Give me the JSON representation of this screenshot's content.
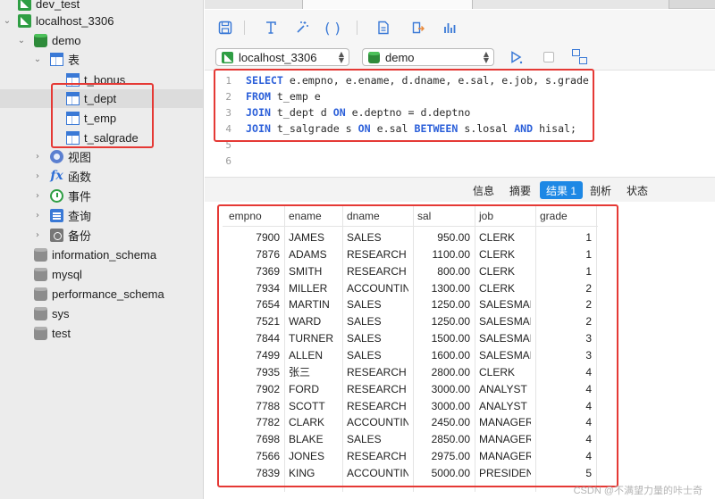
{
  "sidebar": {
    "partial_top": "dev_test",
    "connection": "localhost_3306",
    "database": "demo",
    "tables_group": "表",
    "tables": [
      "t_bonus",
      "t_dept",
      "t_emp",
      "t_salgrade"
    ],
    "folders": [
      "视图",
      "函数",
      "事件",
      "查询",
      "备份"
    ],
    "other_databases": [
      "information_schema",
      "mysql",
      "performance_schema",
      "sys",
      "test"
    ]
  },
  "selectors": {
    "connection": "localhost_3306",
    "database": "demo"
  },
  "editor": {
    "line_numbers": [
      "1",
      "2",
      "3",
      "4",
      "5",
      "6"
    ],
    "lines": [
      {
        "kw": "SELECT",
        "rest": " e.empno, e.ename, d.dname, e.sal, e.job, s.grade"
      },
      {
        "kw": "FROM",
        "rest": " t_emp e"
      },
      {
        "kw": "JOIN",
        "rest": " t_dept d ",
        "kw2": "ON",
        "rest2": " e.deptno = d.deptno"
      },
      {
        "kw": "JOIN",
        "rest": " t_salgrade s ",
        "kw2": "ON",
        "rest2": " e.sal ",
        "kw3": "BETWEEN",
        "rest3": " s.losal ",
        "kw4": "AND",
        "rest4": " hisal;"
      }
    ]
  },
  "result_tabs": [
    "信息",
    "摘要",
    "结果 1",
    "剖析",
    "状态"
  ],
  "result_tab_active": 2,
  "grid": {
    "columns": [
      "empno",
      "ename",
      "dname",
      "sal",
      "job",
      "grade"
    ],
    "rows": [
      [
        "7900",
        "JAMES",
        "SALES",
        "950.00",
        "CLERK",
        "1"
      ],
      [
        "7876",
        "ADAMS",
        "RESEARCH",
        "1100.00",
        "CLERK",
        "1"
      ],
      [
        "7369",
        "SMITH",
        "RESEARCH",
        "800.00",
        "CLERK",
        "1"
      ],
      [
        "7934",
        "MILLER",
        "ACCOUNTING",
        "1300.00",
        "CLERK",
        "2"
      ],
      [
        "7654",
        "MARTIN",
        "SALES",
        "1250.00",
        "SALESMAN",
        "2"
      ],
      [
        "7521",
        "WARD",
        "SALES",
        "1250.00",
        "SALESMAN",
        "2"
      ],
      [
        "7844",
        "TURNER",
        "SALES",
        "1500.00",
        "SALESMAN",
        "3"
      ],
      [
        "7499",
        "ALLEN",
        "SALES",
        "1600.00",
        "SALESMAN",
        "3"
      ],
      [
        "7935",
        "张三",
        "RESEARCH",
        "2800.00",
        "CLERK",
        "4"
      ],
      [
        "7902",
        "FORD",
        "RESEARCH",
        "3000.00",
        "ANALYST",
        "4"
      ],
      [
        "7788",
        "SCOTT",
        "RESEARCH",
        "3000.00",
        "ANALYST",
        "4"
      ],
      [
        "7782",
        "CLARK",
        "ACCOUNTING",
        "2450.00",
        "MANAGER",
        "4"
      ],
      [
        "7698",
        "BLAKE",
        "SALES",
        "2850.00",
        "MANAGER",
        "4"
      ],
      [
        "7566",
        "JONES",
        "RESEARCH",
        "2975.00",
        "MANAGER",
        "4"
      ],
      [
        "7839",
        "KING",
        "ACCOUNTING",
        "5000.00",
        "PRESIDENT",
        "5"
      ]
    ]
  },
  "watermark": "CSDN @不满望力量的咔士奇",
  "colors": {
    "highlight": "#e53935",
    "accent": "#1e88e5",
    "keyword": "#2b5fd9"
  }
}
